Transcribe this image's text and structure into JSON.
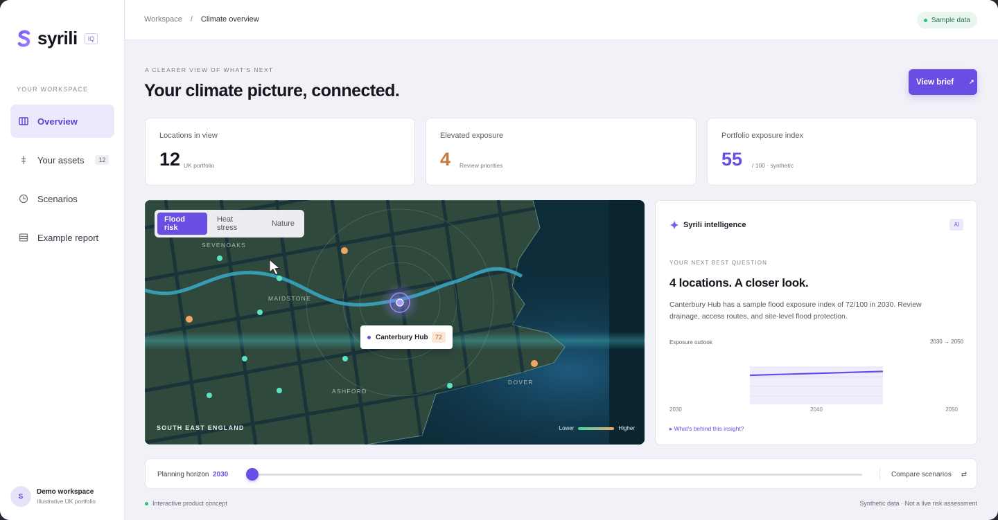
{
  "sidebar": {
    "brand": "syrili",
    "brand_badge": "IQ",
    "section_label": "YOUR WORKSPACE",
    "items": [
      {
        "label": "Overview",
        "icon": "columns-icon"
      },
      {
        "label": "Your assets",
        "icon": "pin-icon",
        "count": "12"
      },
      {
        "label": "Scenarios",
        "icon": "clock-icon"
      },
      {
        "label": "Example report",
        "icon": "document-icon"
      }
    ],
    "profile": {
      "initial": "S",
      "name": "Demo workspace",
      "sub": "Illustrative UK portfolio"
    }
  },
  "topbar": {
    "crumb_root": "Workspace",
    "crumb_sep": "/",
    "crumb_current": "Climate overview",
    "badge": "Sample data"
  },
  "header": {
    "eyebrow": "A CLEARER VIEW OF WHAT'S NEXT",
    "title": "Your climate picture, connected.",
    "brief_button": "View brief",
    "brief_icon": "↗"
  },
  "stats": [
    {
      "label": "Locations in view",
      "value": "12",
      "note": "UK portfolio",
      "color": "#17161f"
    },
    {
      "label": "Elevated exposure",
      "value": "4",
      "note": "Review priorities",
      "color": "#c97a3a"
    },
    {
      "label": "Portfolio exposure index",
      "value": "55",
      "note": "/ 100 · synthetic",
      "color": "#6a4ee3"
    }
  ],
  "map": {
    "tabs": [
      "Flood risk",
      "Heat stress",
      "Nature"
    ],
    "active_tab": "Flood risk",
    "towns": [
      "SEVENOAKS",
      "MAIDSTONE",
      "ASHFORD",
      "DOVER"
    ],
    "region": "SOUTH EAST ENGLAND",
    "legend_low": "Lower",
    "legend_high": "Higher",
    "selected_asset": {
      "name": "Canterbury Hub",
      "score": "72"
    }
  },
  "intel": {
    "title": "Syrili intelligence",
    "tag": "AI",
    "eyebrow": "YOUR NEXT BEST QUESTION",
    "headline": "4 locations. A closer look.",
    "body": "Canterbury Hub has a sample flood exposure index of 72/100 in 2030. Review drainage, access routes, and site-level flood protection.",
    "outlook_label": "Exposure outlook",
    "outlook_range": "2030 → 2050",
    "link": "▸ What's behind this insight?"
  },
  "chart_data": {
    "type": "line",
    "x": [
      2030,
      2050
    ],
    "x_ticks": [
      "2030",
      "2040",
      "2050"
    ],
    "series": [
      {
        "values": [
          72,
          76
        ]
      }
    ],
    "color": "#6a4ee3"
  },
  "horizon": {
    "label": "Planning horizon",
    "year": "2030",
    "compare": "Compare scenarios",
    "compare_icon": "⇄"
  },
  "footer": {
    "left": "Interactive product concept",
    "right": "Synthetic data · Not a live risk assessment"
  }
}
